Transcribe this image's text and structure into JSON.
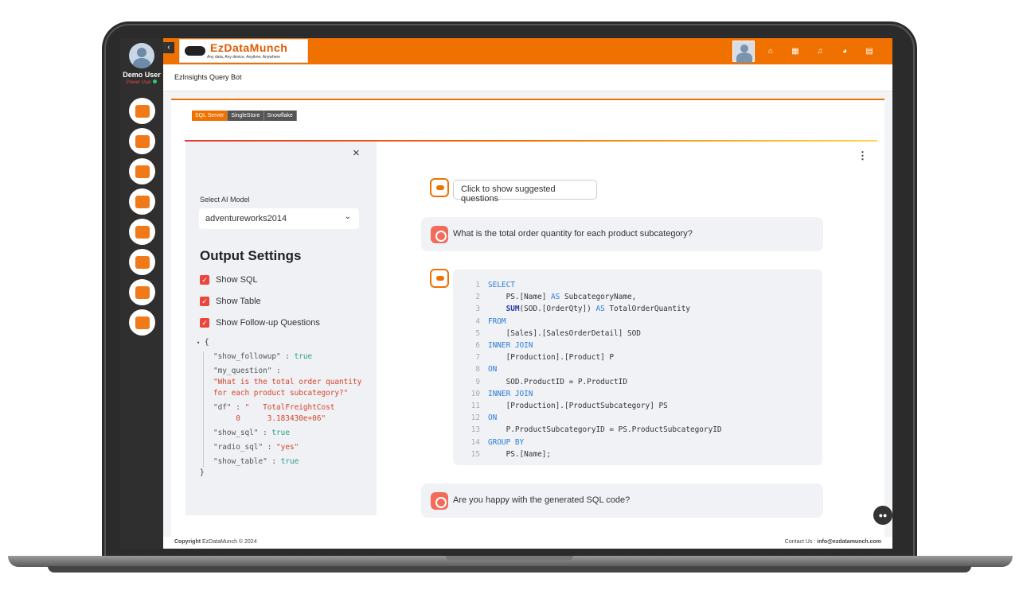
{
  "user": {
    "name": "Demo User",
    "role": "Power User"
  },
  "header": {
    "logo_text": "EzDataMunch",
    "logo_tagline": "Any data, Any device, Anytime, Anywhere",
    "icons": [
      "home-icon",
      "grid-icon",
      "bell-icon",
      "globe-icon",
      "table-icon",
      "help-icon",
      "logout-icon"
    ],
    "icon_glyphs": [
      "⌂",
      "▦",
      "♫",
      "◕",
      "▤",
      "?",
      "↪"
    ]
  },
  "page": {
    "title": "EzInsights Query Bot"
  },
  "db_tabs": [
    {
      "label": "SQL Server",
      "active": true
    },
    {
      "label": "SingleStore",
      "active": false
    },
    {
      "label": "Snowflake",
      "active": false
    }
  ],
  "sidebar": {
    "close_glyph": "×",
    "model_label": "Select AI Model",
    "model_value": "adventureworks2014",
    "output_title": "Output Settings",
    "checks": [
      "Show SQL",
      "Show Table",
      "Show Follow-up Questions"
    ]
  },
  "json_view": {
    "open": "{",
    "close": "}",
    "show_followup_k": "\"show_followup\" :",
    "show_followup_v": "true",
    "my_question_k": "\"my_question\" :",
    "my_question_v": "\"What is the total order quantity for each product subcategory?\"",
    "df_k": "\"df\" :",
    "df_v": "\"   TotalFreightCost\n     0      3.183430e+06\"",
    "show_sql_k": "\"show_sql\" :",
    "show_sql_v": "true",
    "radio_sql_k": "\"radio_sql\" :",
    "radio_sql_v": "\"yes\"",
    "show_table_k": "\"show_table\" :",
    "show_table_v": "true"
  },
  "chat": {
    "suggest_button": "Click to show suggested questions",
    "question": "What is the total order quantity for each product subcategory?",
    "confirm": "Are you happy with the generated SQL code?"
  },
  "sql_lines": [
    "SELECT",
    "    PS.[Name] AS SubcategoryName,",
    "    SUM(SOD.[OrderQty]) AS TotalOrderQuantity",
    "FROM",
    "    [Sales].[SalesOrderDetail] SOD",
    "INNER JOIN",
    "    [Production].[Product] P",
    "ON",
    "    SOD.ProductID = P.ProductID",
    "INNER JOIN",
    "    [Production].[ProductSubcategory] PS",
    "ON",
    "    P.ProductSubcategoryID = PS.ProductSubcategoryID",
    "GROUP BY",
    "    PS.[Name];"
  ],
  "footer": {
    "copyright_bold": "Copyright",
    "copyright": " EzDataMunch © 2024",
    "contact_label": "Contact Us : ",
    "contact_email": "info@ezdatamunch.com"
  },
  "colors": {
    "accent": "#f07000",
    "checkbox": "#e9473c"
  }
}
